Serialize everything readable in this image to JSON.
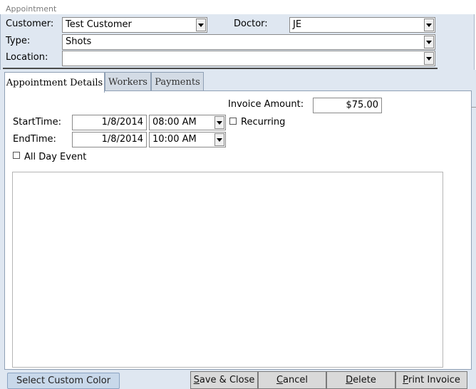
{
  "window": {
    "title": "Appointment"
  },
  "header": {
    "customer": {
      "label": "Customer:",
      "value": "Test Customer"
    },
    "doctor": {
      "label": "Doctor:",
      "value": "JE"
    },
    "type": {
      "label": "Type:",
      "value": "Shots"
    },
    "location": {
      "label": "Location:",
      "value": ""
    }
  },
  "tabs": [
    {
      "label": "Appointment Details",
      "active": true
    },
    {
      "label": "Workers",
      "active": false
    },
    {
      "label": "Payments",
      "active": false
    }
  ],
  "details": {
    "invoice_amount": {
      "label": "Invoice Amount:",
      "value": "$75.00"
    },
    "start": {
      "label": "StartTime:",
      "date": "1/8/2014",
      "time": "08:00 AM"
    },
    "end": {
      "label": "EndTime:",
      "date": "1/8/2014",
      "time": "10:00 AM"
    },
    "recurring": {
      "label": "Recurring",
      "checked": false
    },
    "all_day": {
      "label": "All Day Event",
      "checked": false
    },
    "notes": ""
  },
  "footer": {
    "custom_color": "Select Custom Color",
    "save_close": {
      "accel": "S",
      "rest": "ave & Close"
    },
    "cancel": {
      "accel": "C",
      "rest": "ancel"
    },
    "delete": {
      "accel": "D",
      "rest": "elete"
    },
    "print_invoice": {
      "accel": "P",
      "rest": "rint Invoice"
    }
  },
  "colors": {
    "panel_background": "#dfe7f1",
    "custom_color_button": "#c8d8ea",
    "action_button": "#d9d9d9"
  }
}
